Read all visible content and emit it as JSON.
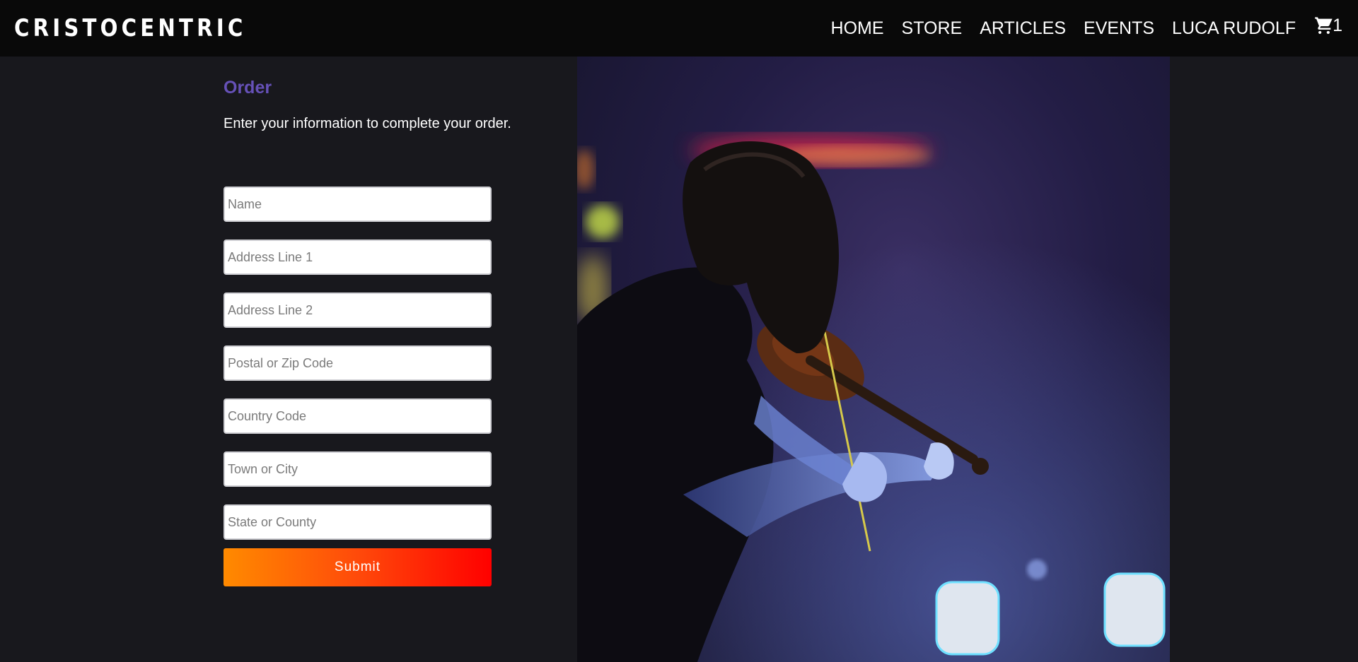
{
  "header": {
    "brand": "CRISTOCENTRIC",
    "nav": [
      "HOME",
      "STORE",
      "ARTICLES",
      "EVENTS",
      "LUCA RUDOLF"
    ],
    "cart": {
      "icon": "cart-icon",
      "count": "1"
    }
  },
  "order": {
    "title": "Order",
    "description": "Enter your information to complete your order.",
    "fields": {
      "name": "Name",
      "address1": "Address Line 1",
      "address2": "Address Line 2",
      "postal": "Postal or Zip Code",
      "country": "Country Code",
      "town": "Town or City",
      "state": "State or County"
    },
    "submit": "Submit"
  },
  "colors": {
    "page_bg": "#18181d",
    "header_bg": "#090909",
    "accent": "#6651b8",
    "button_start": "#ff8a00",
    "button_end": "#ff0000"
  },
  "image": {
    "subject": "violinist-performing-on-stage-photo"
  }
}
